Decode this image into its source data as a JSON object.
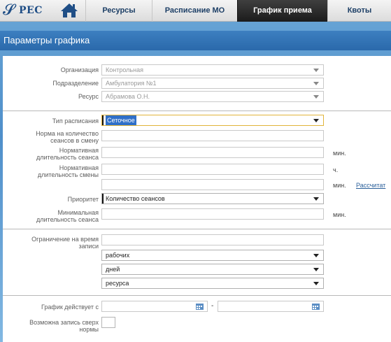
{
  "nav": {
    "logo_text": "РЕС",
    "tabs": [
      {
        "label": "Ресурсы"
      },
      {
        "label": "Расписание МО"
      },
      {
        "label": "График приема",
        "active": true
      },
      {
        "label": "Квоты"
      }
    ]
  },
  "panel": {
    "title": "Параметры графика"
  },
  "form": {
    "organization": {
      "label": "Организация",
      "value": "Контрольная"
    },
    "subdivision": {
      "label": "Подразделение",
      "value": "Амбулатория №1"
    },
    "resource": {
      "label": "Ресурс",
      "value": "Абрамова О.Н."
    },
    "schedule_type": {
      "label": "Тип расписания",
      "value": "Сеточное"
    },
    "sessions_norm": {
      "label_line1": "Норма на количество",
      "label_line2": "сеансов в смену",
      "value": ""
    },
    "session_duration": {
      "label_line1": "Нормативная",
      "label_line2": "длительность сеанса",
      "value": "",
      "unit": "мин."
    },
    "shift_duration": {
      "label_line1": "Нормативная",
      "label_line2": "длительность смены",
      "value": "",
      "unit": "ч."
    },
    "shift_duration_min": {
      "value": "",
      "unit": "мин.",
      "calc_link": "Рассчитат"
    },
    "priority": {
      "label": "Приоритет",
      "value": "Количество сеансов"
    },
    "min_session": {
      "label_line1": "Минимальная",
      "label_line2": "длительность сеанса",
      "value": "",
      "unit": "мин."
    },
    "record_limit": {
      "label_line1": "Ограничение на время",
      "label_line2": "записи",
      "value": ""
    },
    "limit_days_type": {
      "value": "рабочих"
    },
    "limit_unit": {
      "value": "дней"
    },
    "limit_ref": {
      "value": "ресурса"
    },
    "valid_from": {
      "label": "График действует с",
      "value_from": "",
      "value_to": "",
      "dash": "-"
    },
    "overbooking": {
      "label_line1": "Возможна запись сверх",
      "label_line2": "нормы"
    }
  },
  "colors": {
    "header_blue": "#2a69ab",
    "active_tab": "#1b1b1b",
    "link": "#2a5f9a",
    "focus": "#e1b43a",
    "selection": "#2f6fc8"
  }
}
